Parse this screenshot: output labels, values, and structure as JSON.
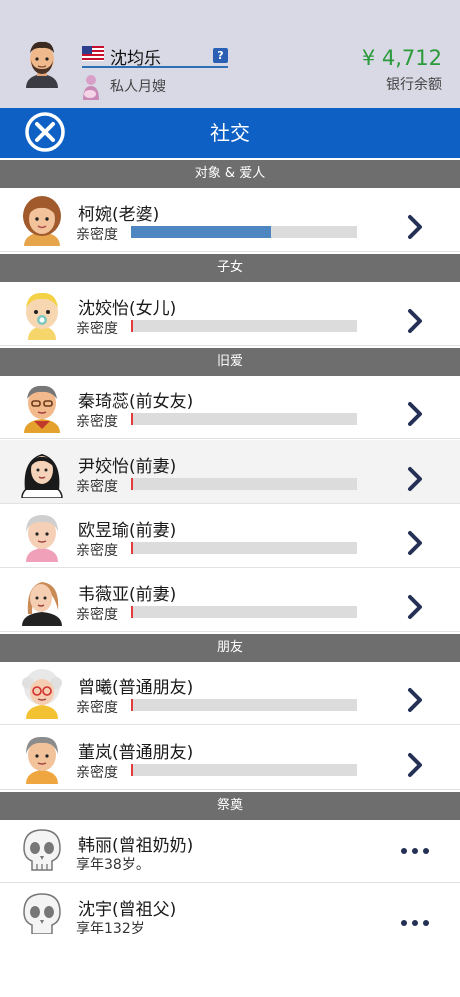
{
  "header": {
    "player_name": "沈均乐",
    "help_icon": "?",
    "job_label": "私人月嫂",
    "money": "¥ 4,712",
    "money_label": "银行余额"
  },
  "titlebar": {
    "title": "社交"
  },
  "sections": [
    {
      "id": "spouse",
      "title": "对象 & 爱人"
    },
    {
      "id": "children",
      "title": "子女"
    },
    {
      "id": "exes",
      "title": "旧爱"
    },
    {
      "id": "friends",
      "title": "朋友"
    },
    {
      "id": "memorial",
      "title": "祭奠"
    }
  ],
  "people": [
    {
      "name": "柯婉",
      "relation": "(老婆)",
      "sub": "亲密度",
      "closeness": 0.62
    },
    {
      "name": "沈姣怡",
      "relation": "(女儿)",
      "sub": "亲密度",
      "closeness": 0.01
    },
    {
      "name": "秦琦蕊",
      "relation": "(前女友)",
      "sub": "亲密度",
      "closeness": 0.01
    },
    {
      "name": "尹姣怡",
      "relation": "(前妻)",
      "sub": "亲密度",
      "closeness": 0.01
    },
    {
      "name": "欧昱瑜",
      "relation": "(前妻)",
      "sub": "亲密度",
      "closeness": 0.01
    },
    {
      "name": "韦薇亚",
      "relation": "(前妻)",
      "sub": "亲密度",
      "closeness": 0.01
    },
    {
      "name": "曾曦",
      "relation": "(普通朋友)",
      "sub": "亲密度",
      "closeness": 0.01
    },
    {
      "name": "董岚",
      "relation": "(普通朋友)",
      "sub": "亲密度",
      "closeness": 0.01
    },
    {
      "name": "韩丽",
      "relation": "(曾祖奶奶)",
      "sub": "享年38岁。"
    },
    {
      "name": "沈宇",
      "relation": "(曾祖父)",
      "sub": "享年132岁"
    }
  ],
  "icons": {
    "close": "close-circle-icon",
    "chevron": "chevron-right-icon",
    "more": "more-dots-icon",
    "flag": "us-flag-icon",
    "skull": "skull-icon"
  },
  "colors": {
    "title_bar": "#0f60c4",
    "section": "#6e6e6e",
    "money": "#2a9a3a",
    "bar_fill": "#4d86c0",
    "bar_low": "#e23b3b",
    "chevron": "#253055"
  }
}
